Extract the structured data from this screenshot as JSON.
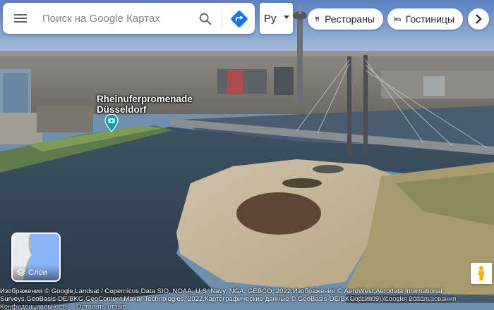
{
  "search": {
    "placeholder": "Поиск на Google Картах"
  },
  "language": {
    "selected": "Ру"
  },
  "chips": [
    {
      "label": "Рестораны",
      "icon": "fork-knife-icon"
    },
    {
      "label": "Гостиницы",
      "icon": "bed-icon"
    }
  ],
  "place": {
    "name_line1": "Rheinuferpromenade",
    "name_line2": "Düsseldorf",
    "icon": "camera-pin-icon"
  },
  "layers": {
    "label": "Слои"
  },
  "attribution": {
    "text": "Изображения © Google,Landsat / Copernicus,Data SIO, NOAA, U.S. Navy, NGA, GEBCO, 2022,Изображения © AeroWest,Aerodata International Surveys,GeoBasis-DE/BKG,GeoContent,Maxar Technologies, 2022,Картографические данные © GeoBasis-DE/BKG (©2009),Google, 2022",
    "region": "Россия",
    "terms": "Условия использования",
    "privacy": "Конфиденциальность",
    "feedback": "Оставить отзыв"
  },
  "colors": {
    "accent": "#1a73e8",
    "place_pin": "#129eaf"
  }
}
